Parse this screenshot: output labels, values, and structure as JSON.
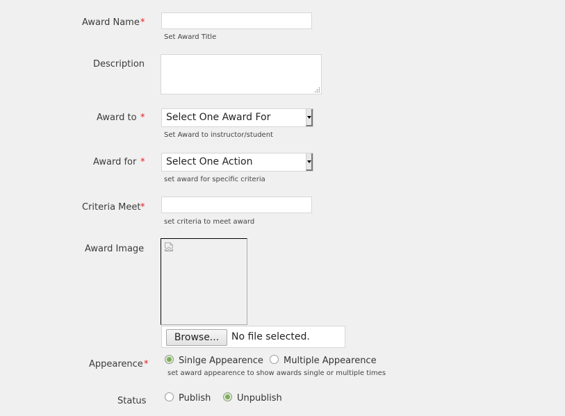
{
  "form": {
    "award_name": {
      "label": "Award Name",
      "required": "*",
      "value": "",
      "hint": "Set Award Title"
    },
    "description": {
      "label": "Description",
      "value": ""
    },
    "award_to": {
      "label": "Award to",
      "required": "*",
      "selected": "Select One Award For",
      "hint": "Set Award to instructor/student"
    },
    "award_for": {
      "label": "Award for",
      "required": "*",
      "selected": "Select One Action",
      "hint": "set award for specific criteria"
    },
    "criteria_meet": {
      "label": "Criteria Meet",
      "required": "*",
      "value": "",
      "hint": "set criteria to meet award"
    },
    "award_image": {
      "label": "Award Image",
      "icon": "broken-image-icon",
      "browse_label": "Browse...",
      "file_status": "No file selected."
    },
    "appearance": {
      "label": "Appearence",
      "required": "*",
      "options": [
        {
          "label": "Sinlge Appearence",
          "checked": true
        },
        {
          "label": "Multiple Appearence",
          "checked": false
        }
      ],
      "hint": "set award appearence to show awards single or multiple times"
    },
    "status": {
      "label": "Status",
      "options": [
        {
          "label": "Publish",
          "checked": false
        },
        {
          "label": "Unpublish",
          "checked": true
        }
      ]
    }
  },
  "colors": {
    "required": "#e02020",
    "radio_checked": "#7cae5a",
    "background": "#f0f0f0"
  }
}
